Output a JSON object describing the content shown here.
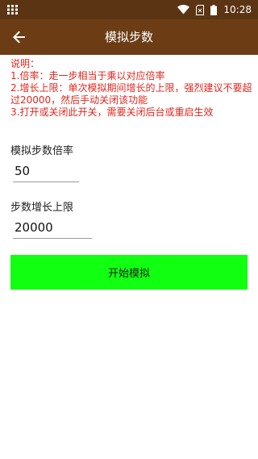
{
  "status_bar": {
    "time": "10:28",
    "bg_color": "#5b3413",
    "icons": [
      "grid-icon",
      "wifi-icon",
      "sim-icon",
      "battery-icon"
    ]
  },
  "toolbar": {
    "title": "模拟步数",
    "bg_color": "#6c3d15",
    "back_icon": "arrow-back-icon"
  },
  "instructions": {
    "color": "#e0261e",
    "lines": [
      "说明：",
      "1.倍率：走一步相当于乘以对应倍率",
      "2.增长上限：单次模拟期间增长的上限，强烈建议不要超过20000，然后手动关闭该功能",
      "3.打开或关闭此开关，需要关闭后台或重启生效"
    ]
  },
  "form": {
    "multiplier": {
      "label": "模拟步数倍率",
      "value": "50"
    },
    "limit": {
      "label": "步数增长上限",
      "value": "20000"
    }
  },
  "start_button": {
    "label": "开始模拟",
    "bg_color": "#11ff11"
  }
}
